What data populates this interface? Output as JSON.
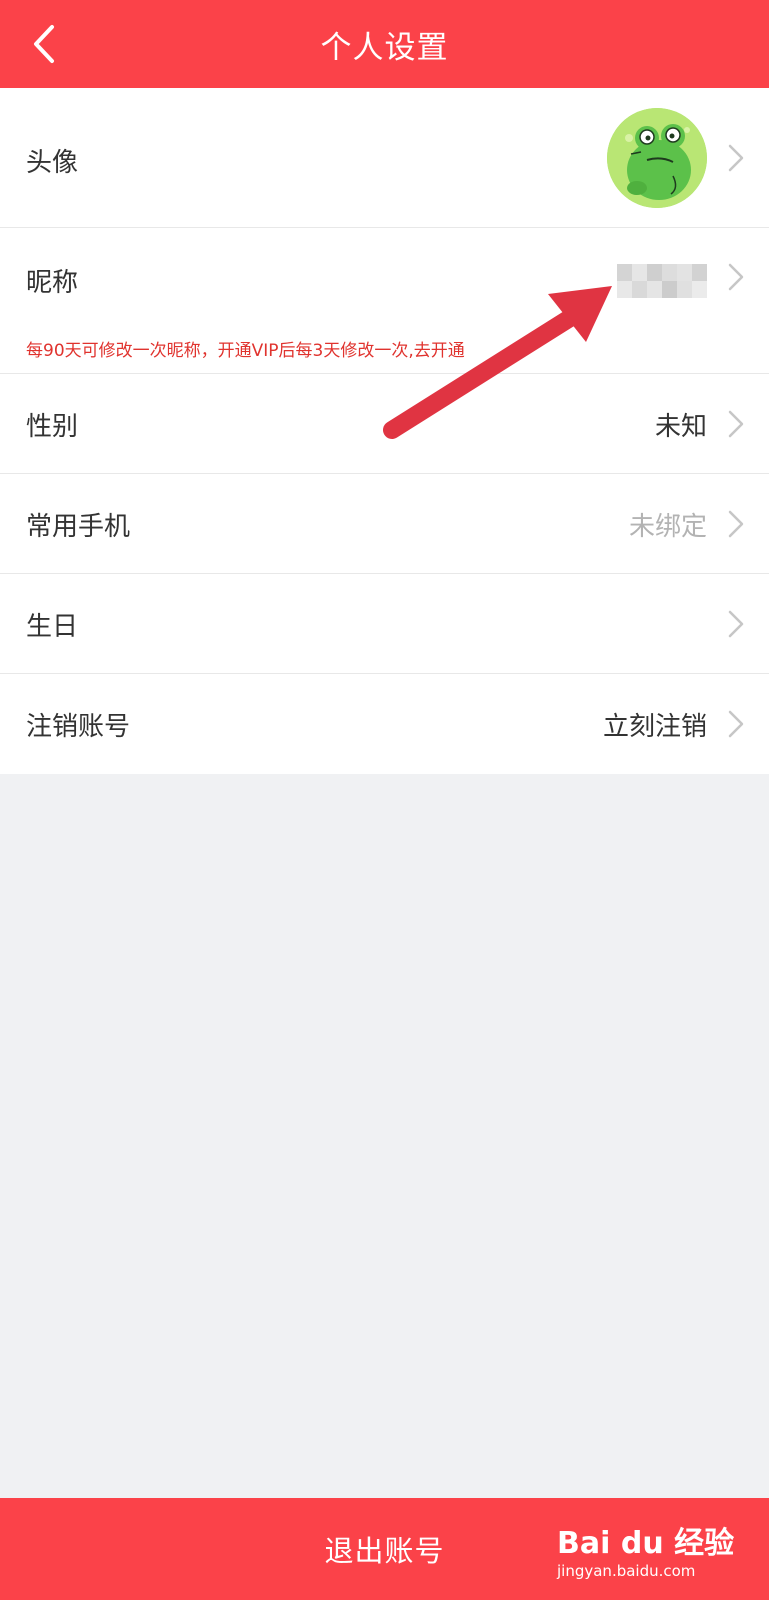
{
  "header": {
    "title": "个人设置",
    "back_icon": "chevron-left-icon"
  },
  "rows": {
    "avatar": {
      "label": "头像"
    },
    "nickname": {
      "label": "昵称",
      "value_state": "blurred",
      "note": "每90天可修改一次昵称，开通VIP后每3天修改一次,去开通"
    },
    "gender": {
      "label": "性别",
      "value": "未知"
    },
    "phone": {
      "label": "常用手机",
      "value": "未绑定"
    },
    "birthday": {
      "label": "生日",
      "value": ""
    },
    "cancel_account": {
      "label": "注销账号",
      "value": "立刻注销"
    }
  },
  "footer": {
    "logout_label": "退出账号"
  },
  "watermark": {
    "logo": "Bai du 经验",
    "sub": "jingyan.baidu.com"
  },
  "colors": {
    "brand_red": "#fb4249",
    "note_red": "#e0332e",
    "arrow_red": "#e03442",
    "background": "#f0f1f3"
  }
}
